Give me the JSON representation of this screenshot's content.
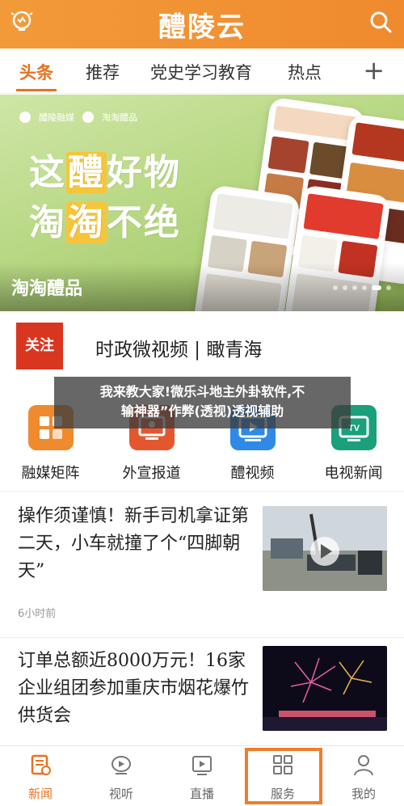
{
  "header": {
    "logo": "醴陵云",
    "icons": [
      "bulb-icon",
      "search-icon"
    ]
  },
  "tabs": [
    {
      "label": "头条",
      "active": true
    },
    {
      "label": "推荐"
    },
    {
      "label": "党史学习教育"
    },
    {
      "label": "热点"
    }
  ],
  "tab_add_label": "+",
  "banner": {
    "brands": [
      "醴陵融媒",
      "淘淘醴品"
    ],
    "slogan_line1_a": "这",
    "slogan_line1_hl": "醴",
    "slogan_line1_b": "好物",
    "slogan_line2_a": "淘",
    "slogan_line2_hl": "淘",
    "slogan_line2_b": "不绝",
    "caption": "淘淘醴品"
  },
  "follow": {
    "badge": "关注",
    "text": "时政微视频 | 瞰青海"
  },
  "grid": [
    {
      "label": "融媒矩阵",
      "icon": "matrix-icon",
      "color": "#f08a2e"
    },
    {
      "label": "外宣报道",
      "icon": "report-icon",
      "color": "#e4572e"
    },
    {
      "label": "醴视频",
      "icon": "video-icon",
      "color": "#2e8ae6"
    },
    {
      "label": "电视新闻",
      "icon": "tv-icon",
      "color": "#1aa07a"
    }
  ],
  "overlay": {
    "line1": "我来教大家!微乐斗地主外卦软件,不",
    "line2": "输神器”作弊(透视)透视辅助"
  },
  "news": [
    {
      "title": "操作须谨慎！新手司机拿证第二天，小车就撞了个“四脚朝天”",
      "time": "6小时前",
      "thumb": "accident-photo",
      "has_video": true
    },
    {
      "title": "订单总额近8000万元！16家企业组团参加重庆市烟花爆竹供货会",
      "time": "",
      "thumb": "fireworks-photo"
    }
  ],
  "bottom_nav": [
    {
      "label": "新闻",
      "icon": "news-icon",
      "active": true
    },
    {
      "label": "视听",
      "icon": "av-icon"
    },
    {
      "label": "直播",
      "icon": "live-icon"
    },
    {
      "label": "服务",
      "icon": "service-icon"
    },
    {
      "label": "我的",
      "icon": "profile-icon"
    }
  ],
  "colors": {
    "brand": "#f08a2e",
    "accent": "#e8711f"
  }
}
